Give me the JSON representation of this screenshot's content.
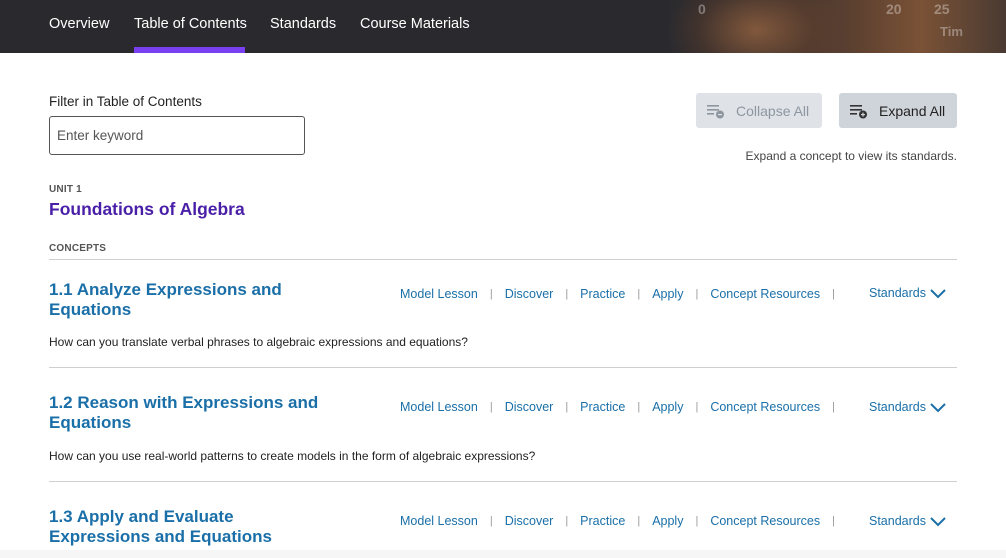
{
  "nav": {
    "tabs": [
      "Overview",
      "Table of Contents",
      "Standards",
      "Course Materials"
    ],
    "active_tab": "Table of Contents",
    "banner_numbers": [
      "0",
      "20",
      "25",
      "Tim"
    ]
  },
  "filter": {
    "label": "Filter in Table of Contents",
    "placeholder": "Enter keyword",
    "value": ""
  },
  "toolbar": {
    "collapse_label": "Collapse All",
    "expand_label": "Expand All",
    "hint": "Expand a concept to view its standards."
  },
  "unit": {
    "label": "UNIT 1",
    "title": "Foundations of Algebra",
    "concepts_label": "CONCEPTS"
  },
  "concepts": [
    {
      "title": "1.1 Analyze Expressions and Equations",
      "question": "How can you translate verbal phrases to algebraic expressions and equations?",
      "links": [
        "Model Lesson",
        "Discover",
        "Practice",
        "Apply",
        "Concept Resources"
      ],
      "standards_label": "Standards"
    },
    {
      "title": "1.2 Reason with Expressions and Equations",
      "question": "How can you use real-world patterns to create models in the form of algebraic expressions?",
      "links": [
        "Model Lesson",
        "Discover",
        "Practice",
        "Apply",
        "Concept Resources"
      ],
      "standards_label": "Standards"
    },
    {
      "title": "1.3 Apply and Evaluate Expressions and Equations",
      "question": "",
      "links": [
        "Model Lesson",
        "Discover",
        "Practice",
        "Apply",
        "Concept Resources"
      ],
      "standards_label": "Standards"
    }
  ],
  "colors": {
    "nav_bg": "#2a2a2e",
    "active_underline": "#7a3ff0",
    "unit_title": "#4a1fa8",
    "link": "#1a6fa8"
  }
}
